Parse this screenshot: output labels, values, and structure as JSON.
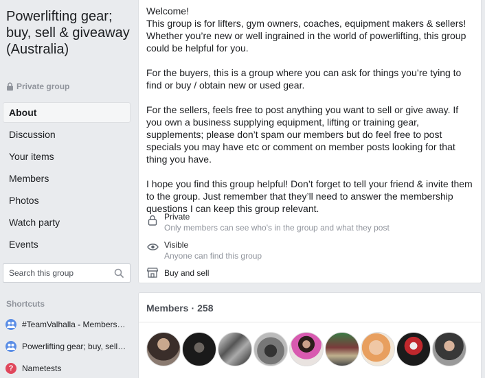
{
  "sidebar": {
    "group_name": "Powerlifting gear; buy, sell & giveaway (Australia)",
    "privacy_label": "Private group",
    "nav_items": [
      "About",
      "Discussion",
      "Your items",
      "Members",
      "Photos",
      "Watch party",
      "Events"
    ],
    "active_item": "About",
    "search_placeholder": "Search this group",
    "shortcuts_header": "Shortcuts",
    "shortcuts": [
      {
        "label": "#TeamValhalla - Members Only",
        "icon": "group-icon"
      },
      {
        "label": "Powerlifting gear; buy, sell & giveaway",
        "icon": "group-icon"
      },
      {
        "label": "Nametests",
        "icon": "question-icon"
      }
    ]
  },
  "about": {
    "paragraphs": [
      "Welcome!\nThis group is for lifters, gym owners, coaches, equipment makers & sellers! Whether you’re new or well ingrained in the world of powerlifting, this group could be helpful for you.",
      "For the buyers, this is a group where you can ask for things you’re tying to find or buy / obtain new or used gear.",
      "For the sellers, feels free to post anything you want to sell or give away. If you own a business supplying equipment, lifting or training gear, supplements; please don’t spam our members but do feel free to post specials you may have etc or comment on member posts looking for that thing you have.",
      "I hope you find this group helpful! Don’t forget to tell your friend & invite them to the group. Just remember that they’ll need to answer the membership questions I can keep this group relevant."
    ],
    "private_title": "Private",
    "private_desc": "Only members can see who's in the group and what they post",
    "visible_title": "Visible",
    "visible_desc": "Anyone can find this group",
    "buy_sell_label": "Buy and sell"
  },
  "members": {
    "label": "Members",
    "count": "258"
  },
  "colors": {
    "shortcut_group": "#5b8ee6",
    "shortcut_question": "#e0475c"
  }
}
